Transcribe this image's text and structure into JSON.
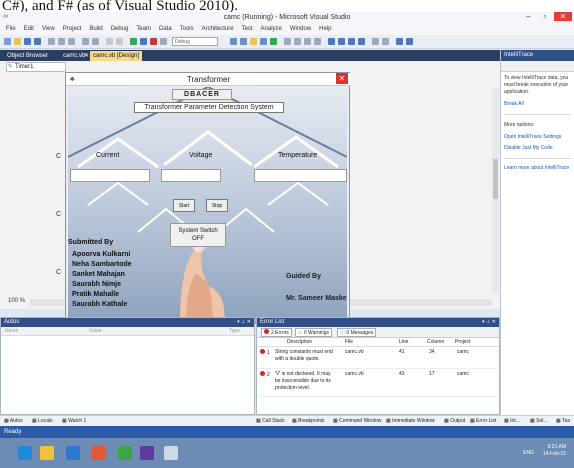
{
  "caption": "C#), and F# (as of Visual Studio 2010).",
  "window": {
    "title": "camc (Running) - Microsoft Visual Studio",
    "minimize": "–",
    "restore": "▫",
    "close": "✕"
  },
  "menu": [
    "File",
    "Edit",
    "View",
    "Project",
    "Build",
    "Debug",
    "Team",
    "Data",
    "Tools",
    "Architecture",
    "Test",
    "Analyze",
    "Window",
    "Help"
  ],
  "toolbar": {
    "config_value": "Debug"
  },
  "tabs": [
    {
      "label": "Object Browser"
    },
    {
      "label": "camc.vb"
    },
    {
      "label": "camc.vb [Design]"
    }
  ],
  "designer": {
    "component_tab": "Timer1",
    "strip_letter": "C",
    "zoom": "100 %"
  },
  "form": {
    "title": "Transformer",
    "icon": "♣",
    "brand": "DBACER",
    "system_name": "Transformer Parameter  Detection System",
    "labels": {
      "current": "Current",
      "voltage": "Voltage",
      "temperature": "Temperature"
    },
    "start_label": "Start",
    "stop_label": "Stop",
    "switch_label_line1": "System Switch",
    "switch_label_line2": "OFF",
    "submitted_by": "Submitted By",
    "members": [
      "Apoorva Kulkarni",
      "Neha Sambartode",
      "Sanket Mahajan",
      "Saurabh Nimje",
      "Pratik Mahalle",
      "Saurabh Kathale"
    ],
    "guided_by": "Guided By",
    "guide_name": "Mr. Sameer Maske"
  },
  "intellitrace": {
    "title": "IntelliTrace",
    "body": "To view IntelliTrace data, you must break execution of your application.",
    "break_all": "Break All",
    "more_options": "More options:",
    "links": [
      "Open IntelliTrace Settings",
      "Disable Just My Code",
      "Learn more about IntelliTrace"
    ]
  },
  "autos": {
    "title": "Autos",
    "columns": [
      "Name",
      "Value",
      "Type"
    ]
  },
  "error_list": {
    "title": "Error List",
    "filters": {
      "errors": "2 Errors",
      "warnings": "0 Warnings",
      "messages": "0 Messages"
    },
    "columns": [
      "Description",
      "File",
      "Line",
      "Column",
      "Project"
    ],
    "rows": [
      {
        "num": "1",
        "description": "String constants must end with a double quote.",
        "file": "camc.vb",
        "line": "41",
        "column": "34",
        "project": "camc"
      },
      {
        "num": "2",
        "description": "'V' is not declared. It may be inaccessible due to its protection level.",
        "file": "camc.vb",
        "line": "43",
        "column": "17",
        "project": "camc"
      }
    ]
  },
  "bottom_tabs_left": [
    "Autos",
    "Locals",
    "Watch 1"
  ],
  "bottom_tabs_right": [
    "Call Stack",
    "Breakpoints",
    "Command Window",
    "Immediate Window",
    "Output",
    "Error List",
    "Int...",
    "Sol...",
    "Tea"
  ],
  "status": "Ready",
  "clock": {
    "time": "9:21 AM",
    "date": "14-Feb-15",
    "lang": "ENG"
  },
  "colors": {
    "accent": "#2f4f86",
    "status_bar": "#2b5aa8",
    "active_tab": "#f5d98c",
    "close_red": "#d9352f"
  }
}
